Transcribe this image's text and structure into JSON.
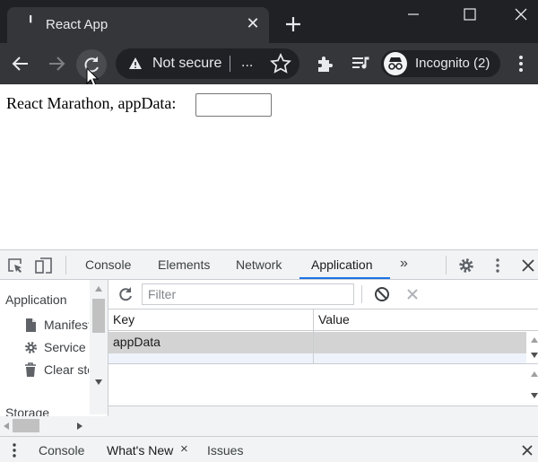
{
  "browser": {
    "tab_title": "React App",
    "tab_favicon": "react-icon",
    "address_text": "Not secure",
    "address_ellipsis": "...",
    "profile_label": "Incognito (2)",
    "theme": {
      "frame": "#202124",
      "toolbar": "#35363a",
      "text": "#e8eaed"
    }
  },
  "page": {
    "label": "React Marathon, appData:",
    "input_value": ""
  },
  "devtools": {
    "tabs": [
      "Console",
      "Elements",
      "Network",
      "Application"
    ],
    "active_tab": "Application",
    "more_tabs": "»",
    "sidebar": {
      "heading": "Application",
      "items": [
        {
          "icon": "file-icon",
          "label": "Manifest"
        },
        {
          "icon": "gear-icon",
          "label": "Service Workers"
        },
        {
          "icon": "trash-icon",
          "label": "Clear storage"
        }
      ],
      "section": "Storage"
    },
    "filter_placeholder": "Filter",
    "table": {
      "columns": [
        "Key",
        "Value"
      ],
      "rows": [
        {
          "key": "appData",
          "value": ""
        }
      ]
    },
    "drawer": {
      "tabs": [
        "Console",
        "What's New",
        "Issues"
      ],
      "active": "What's New",
      "close": "×"
    },
    "accent": "#1a73e8"
  }
}
